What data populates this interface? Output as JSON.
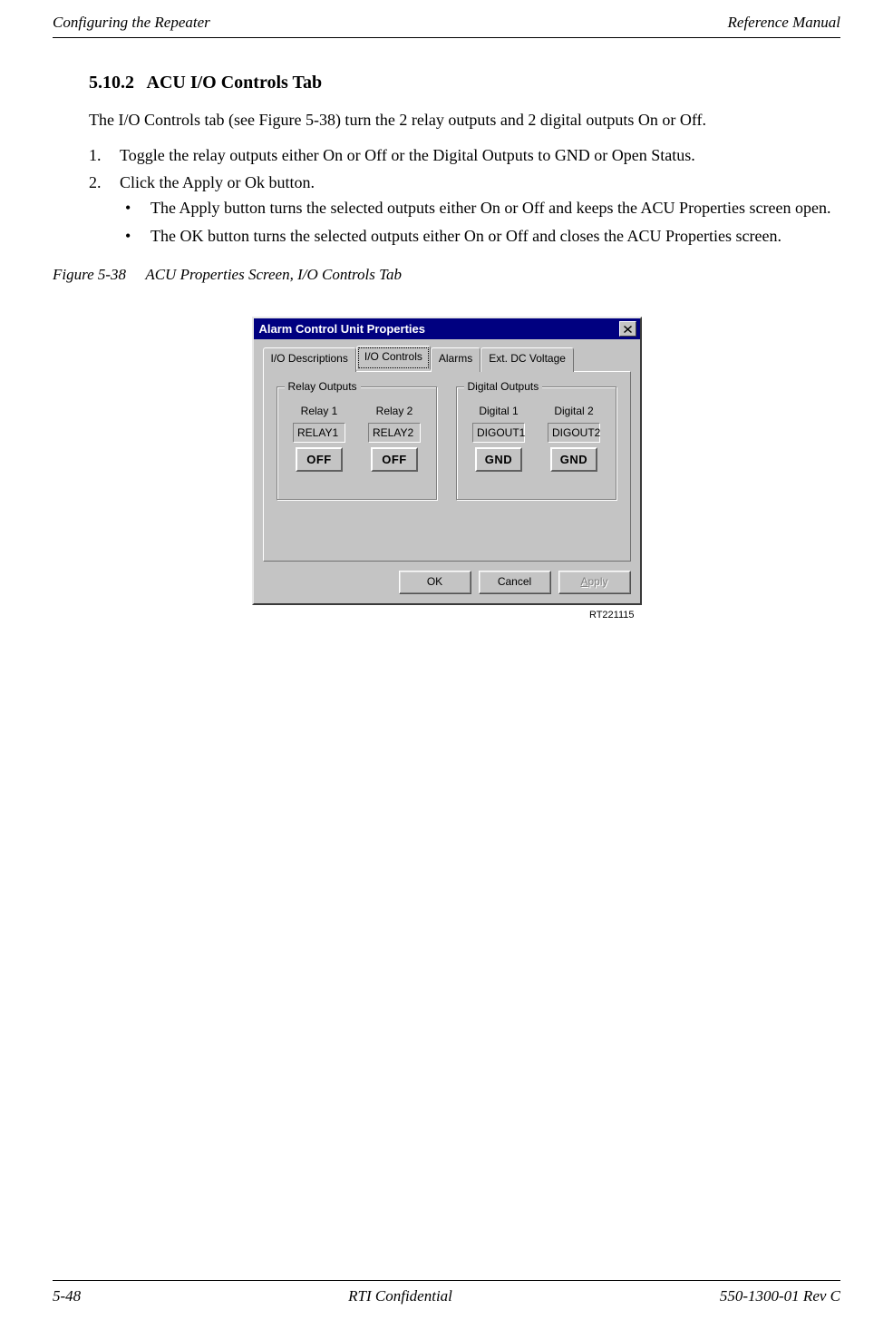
{
  "header": {
    "left": "Configuring the Repeater",
    "right": "Reference Manual"
  },
  "section": {
    "number": "5.10.2",
    "title": "ACU I/O Controls Tab"
  },
  "intro": "The I/O Controls tab (see Figure 5-38) turn the 2 relay outputs and 2 digital outputs On or Off.",
  "steps": [
    {
      "num": "1.",
      "text": "Toggle the relay outputs either On or Off or the Digital Outputs to GND or Open Status."
    },
    {
      "num": "2.",
      "text": "Click the Apply or Ok button."
    }
  ],
  "bullets": [
    "The Apply button turns the selected outputs either On or Off and keeps the ACU Properties screen open.",
    "The OK button turns the selected outputs either On or Off and closes the ACU Properties screen."
  ],
  "figure": {
    "label": "Figure 5-38",
    "caption": "ACU Properties Screen, I/O Controls Tab",
    "image_ref": "RT221115"
  },
  "dialog": {
    "title": "Alarm Control Unit Properties",
    "tabs": [
      "I/O Descriptions",
      "I/O Controls",
      "Alarms",
      "Ext. DC Voltage"
    ],
    "active_tab": 1,
    "groups": {
      "relay": {
        "legend": "Relay Outputs",
        "cols": [
          {
            "label": "Relay 1",
            "name": "RELAY1",
            "state": "OFF"
          },
          {
            "label": "Relay 2",
            "name": "RELAY2",
            "state": "OFF"
          }
        ]
      },
      "digital": {
        "legend": "Digital Outputs",
        "cols": [
          {
            "label": "Digital 1",
            "name": "DIGOUT1",
            "state": "GND"
          },
          {
            "label": "Digital 2",
            "name": "DIGOUT2",
            "state": "GND"
          }
        ]
      }
    },
    "buttons": {
      "ok": "OK",
      "cancel": "Cancel",
      "apply": "pply",
      "apply_prefix": "A"
    }
  },
  "footer": {
    "left": "5-48",
    "center": "RTI Confidential",
    "right": "550-1300-01 Rev C"
  }
}
